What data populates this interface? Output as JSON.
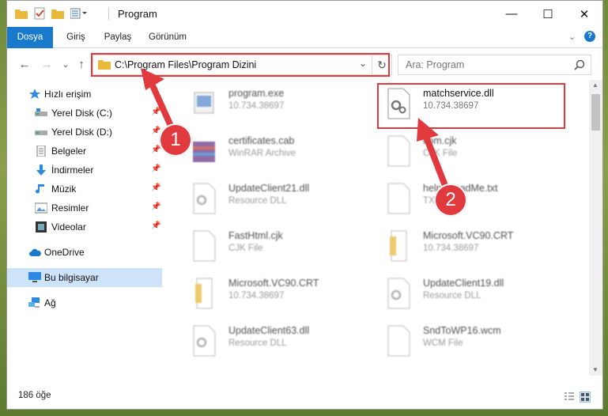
{
  "window": {
    "title": "Program",
    "minimize": "—",
    "maximize": "☐",
    "close": "✕"
  },
  "ribbon": {
    "tabs": [
      "Dosya",
      "Giriş",
      "Paylaş",
      "Görünüm"
    ],
    "help": "?"
  },
  "nav": {
    "back": "←",
    "forward": "→",
    "recent": "⌄",
    "up": "↑"
  },
  "address": {
    "path": "C:\\Program Files\\Program Dizini",
    "refresh": "↻"
  },
  "search": {
    "placeholder": "Ara: Program"
  },
  "sidebar": {
    "items": [
      {
        "label": "Hızlı erişim",
        "icon": "star-icon",
        "pinned": false
      },
      {
        "label": "Yerel Disk (C:)",
        "icon": "drive-icon",
        "pinned": true
      },
      {
        "label": "Yerel Disk (D:)",
        "icon": "drive-icon",
        "pinned": true
      },
      {
        "label": "Belgeler",
        "icon": "documents-icon",
        "pinned": true
      },
      {
        "label": "İndirmeler",
        "icon": "download-icon",
        "pinned": true
      },
      {
        "label": "Müzik",
        "icon": "music-icon",
        "pinned": true
      },
      {
        "label": "Resimler",
        "icon": "pictures-icon",
        "pinned": true
      },
      {
        "label": "Videolar",
        "icon": "videos-icon",
        "pinned": true
      },
      {
        "label": "OneDrive",
        "icon": "cloud-icon",
        "pinned": false
      },
      {
        "label": "Bu bilgisayar",
        "icon": "computer-icon",
        "pinned": false
      },
      {
        "label": "Ağ",
        "icon": "network-icon",
        "pinned": false
      }
    ]
  },
  "files": [
    {
      "name": "program.exe",
      "sub": "10.734.38697",
      "icon": "exe-icon"
    },
    {
      "name": "matchservice.dll",
      "sub": "10.734.38697",
      "icon": "dll-gear-icon"
    },
    {
      "name": "certificates.cab",
      "sub": "WinRAR Archive",
      "icon": "archive-icon"
    },
    {
      "name": "com.cjk",
      "sub": "CJK File",
      "icon": "blank-file-icon"
    },
    {
      "name": "UpdateClient21.dll",
      "sub": "Resource DLL",
      "icon": "dll-gear-icon"
    },
    {
      "name": "help_ReadMe.txt",
      "sub": "TXT File",
      "icon": "blank-file-icon"
    },
    {
      "name": "FastHtml.cjk",
      "sub": "CJK File",
      "icon": "blank-file-icon"
    },
    {
      "name": "Microsoft.VC90.CRT",
      "sub": "10.734.38697",
      "icon": "folder-file-icon"
    },
    {
      "name": "Microsoft.VC90.CRT",
      "sub": "10.734.38697",
      "icon": "folder-file-icon"
    },
    {
      "name": "UpdateClient19.dll",
      "sub": "Resource DLL",
      "icon": "dll-gear-icon"
    },
    {
      "name": "UpdateClient63.dll",
      "sub": "Resource DLL",
      "icon": "dll-gear-icon"
    },
    {
      "name": "SndToWP16.wcm",
      "sub": "WCM File",
      "icon": "blank-file-icon"
    }
  ],
  "status": {
    "count": "186 öğe"
  },
  "annotations": {
    "badge1": "1",
    "badge2": "2"
  },
  "colors": {
    "accent": "#1979ca",
    "highlight": "#e0393e",
    "selected": "#cde3f7"
  }
}
